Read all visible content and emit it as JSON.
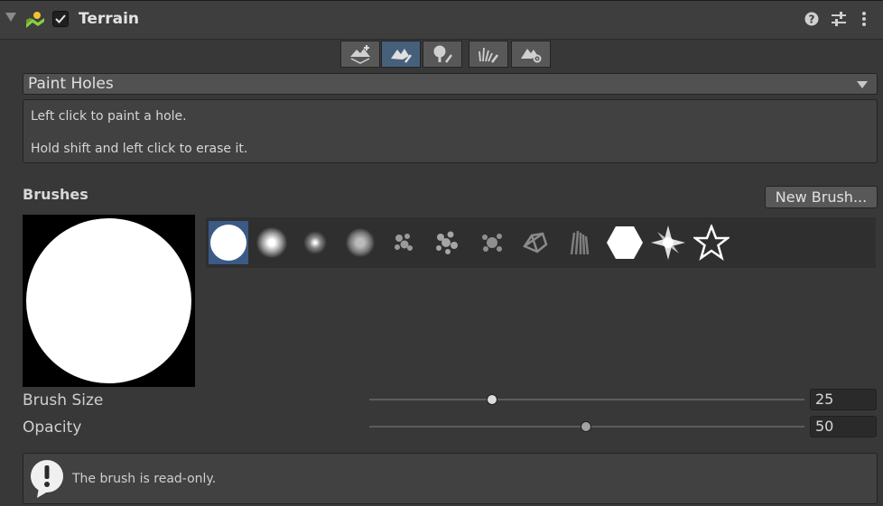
{
  "header": {
    "title": "Terrain",
    "enabled": true,
    "icons": [
      "foldout-arrow-icon",
      "terrain-icon",
      "help-icon",
      "preset-icon",
      "more-menu-icon"
    ]
  },
  "toolbar": {
    "tools": [
      {
        "name": "create-neighbor-terrains",
        "icon": "terrain-add-icon",
        "active": false
      },
      {
        "name": "paint-terrain",
        "icon": "terrain-brush-icon",
        "active": true
      },
      {
        "name": "paint-trees",
        "icon": "tree-brush-icon",
        "active": false
      },
      {
        "name": "paint-details",
        "icon": "grass-brush-icon",
        "active": false
      },
      {
        "name": "terrain-settings",
        "icon": "terrain-gear-icon",
        "active": false
      }
    ]
  },
  "mode": {
    "selected": "Paint Holes"
  },
  "help": {
    "line1": "Left click to paint a hole.",
    "line2": "Hold shift and left click to erase it."
  },
  "brushes": {
    "label": "Brushes",
    "new_brush_label": "New Brush...",
    "selected_index": 0,
    "count": 12
  },
  "settings": {
    "brush_size": {
      "label": "Brush Size",
      "value": "25",
      "fraction": 0.29
    },
    "opacity": {
      "label": "Opacity",
      "value": "50",
      "fraction": 0.5
    }
  },
  "info": {
    "text": "The brush is read-only.",
    "icon": "warning-bubble-icon"
  },
  "colors": {
    "background": "#383838",
    "selected": "#3b5a86",
    "active_tool": "#46607c"
  }
}
